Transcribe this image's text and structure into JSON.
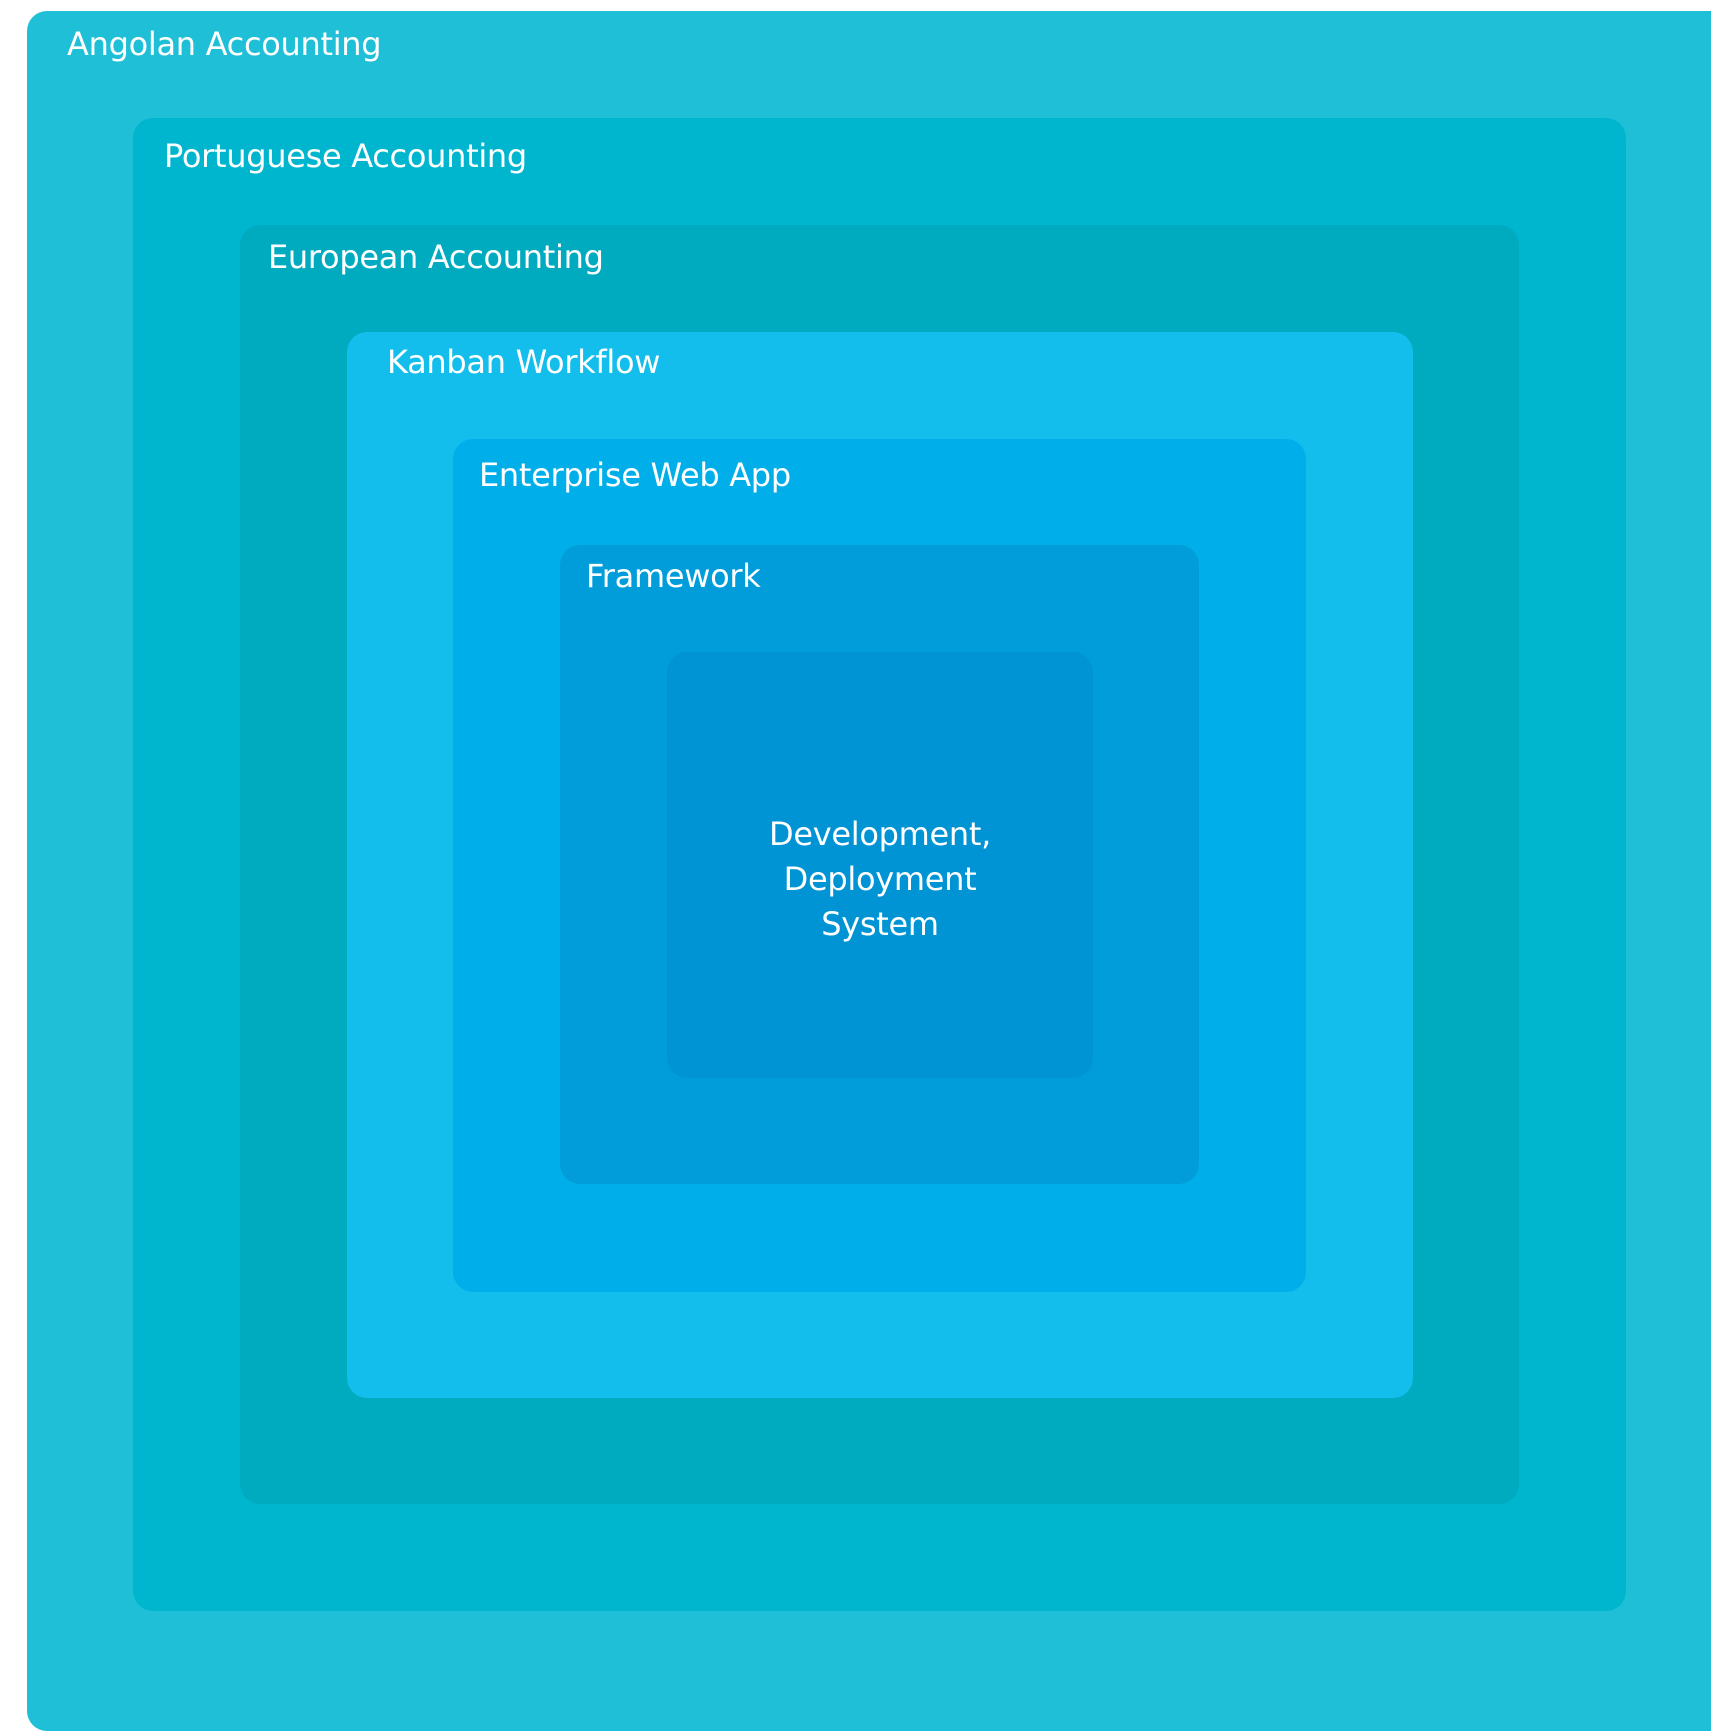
{
  "diagram": {
    "layers": [
      {
        "label": "Angolan Accounting",
        "color": "#1fbfd8"
      },
      {
        "label": "Portuguese Accounting",
        "color": "#00b6cf"
      },
      {
        "label": "European Accounting",
        "color": "#00abc0"
      },
      {
        "label": "Kanban Workflow",
        "color": "#13bdec"
      },
      {
        "label": "Enterprise Web App",
        "color": "#00afea"
      },
      {
        "label": "Framework",
        "color": "#009dda"
      }
    ],
    "core": {
      "lines": [
        "Development,",
        "Deployment",
        "System"
      ],
      "color": "#0094d4"
    }
  }
}
